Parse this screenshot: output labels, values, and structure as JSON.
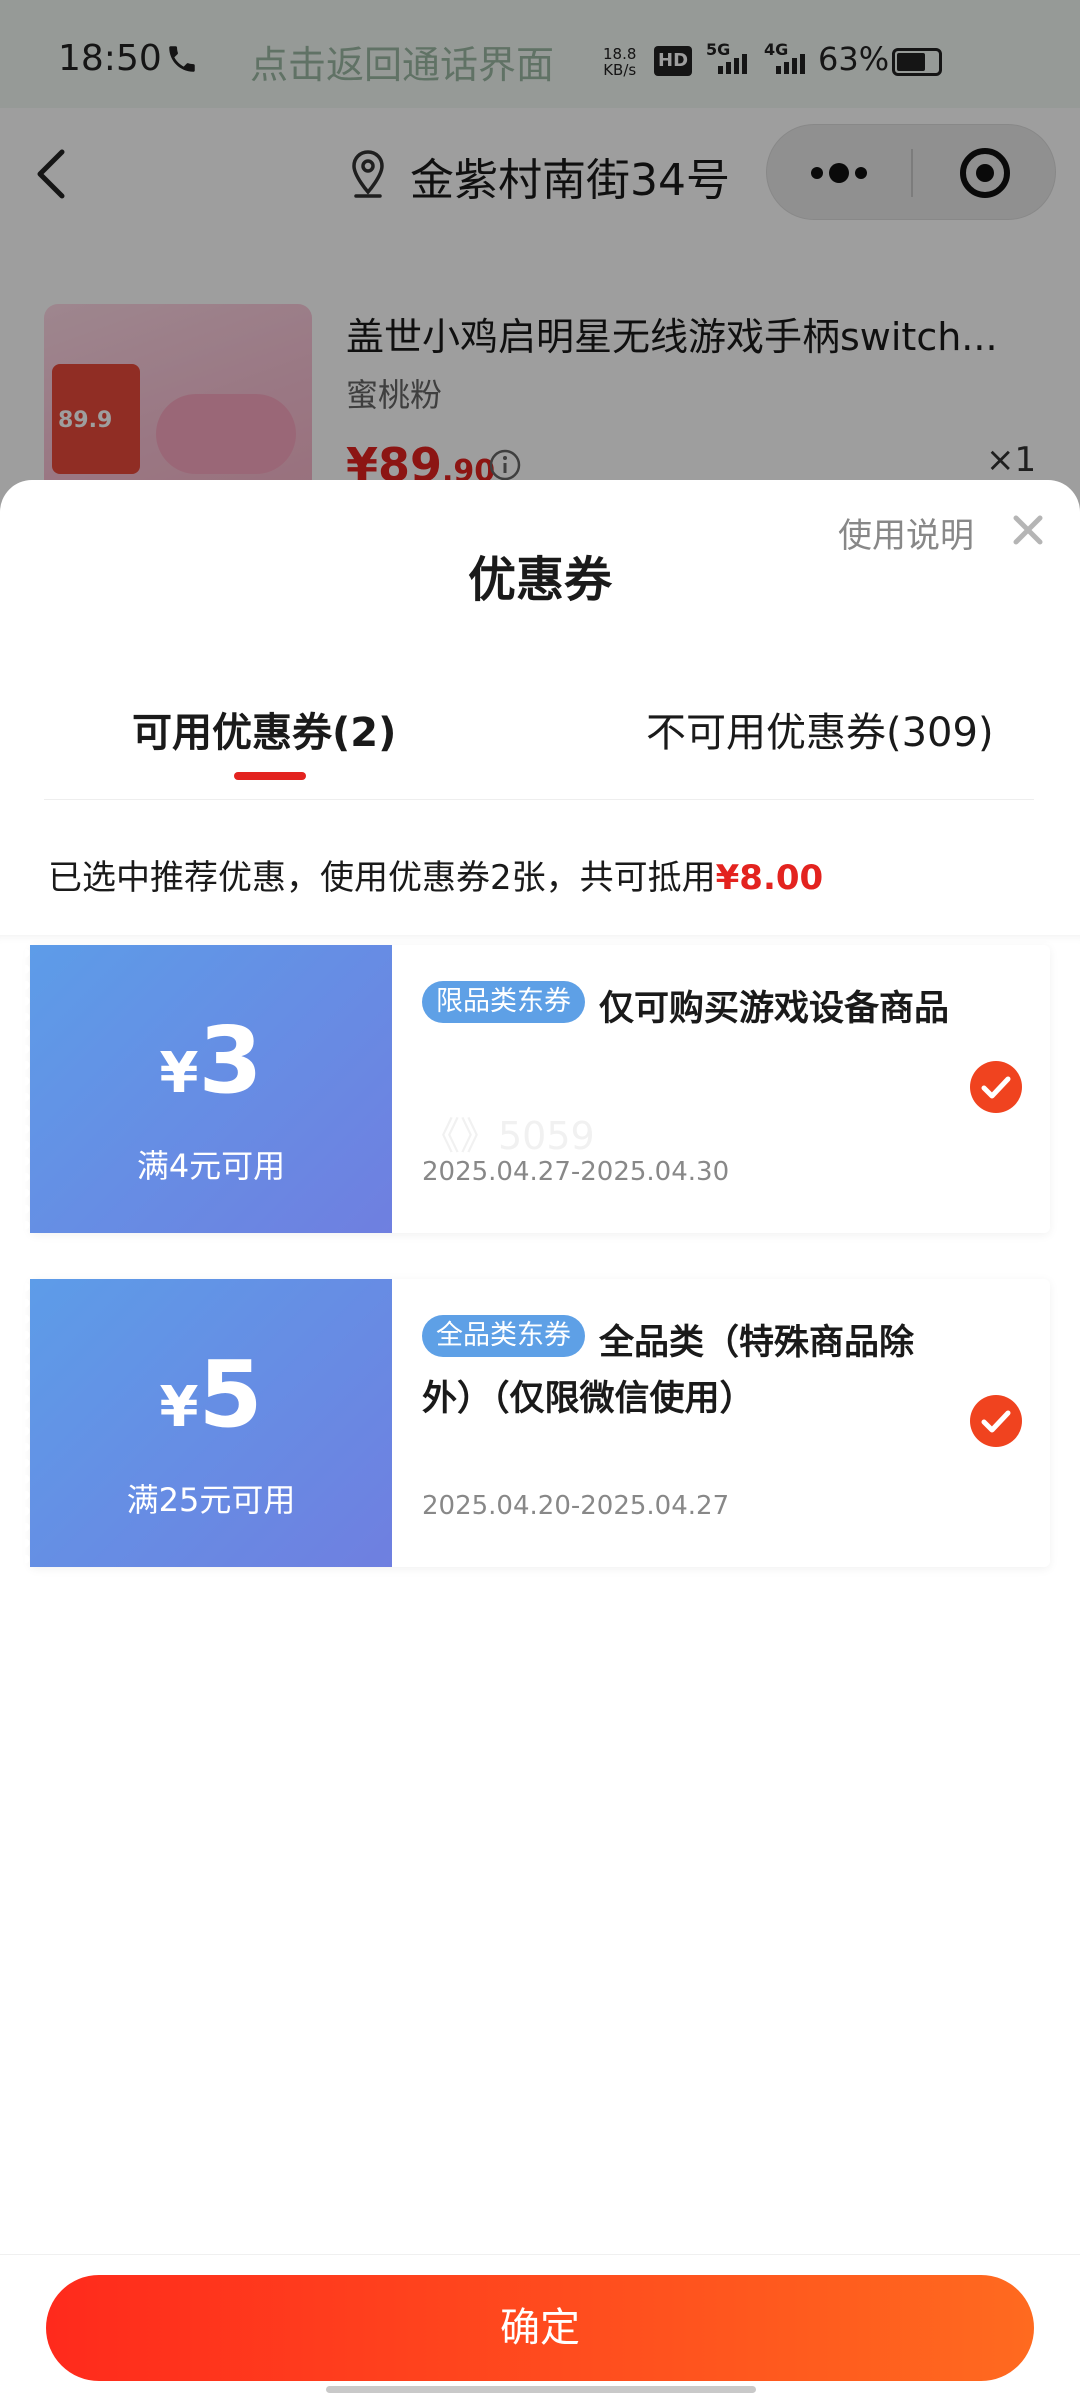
{
  "status_bar": {
    "time": "18:50",
    "call_text": "点击返回通话界面",
    "net_speed_top": "18.8",
    "net_speed_bottom": "KB/s",
    "hd_label": "HD",
    "signal_1_label": "5G",
    "signal_2_label": "4G",
    "battery_percent": "63%",
    "battery_level": 0.63
  },
  "nav": {
    "location": "金紫村南街34号"
  },
  "product": {
    "title": "盖世小鸡启明星无线游戏手柄switch...",
    "variant": "蜜桃粉",
    "price_main": "¥89",
    "price_decimal": ".90",
    "quantity": "×1",
    "thumb_price": "89.9"
  },
  "sheet": {
    "help_link": "使用说明",
    "title": "优惠券",
    "tab_available": "可用优惠券(2)",
    "tab_unavailable": "不可用优惠券(309)",
    "summary_prefix": "已选中推荐优惠，使用优惠券2张，共可抵用",
    "summary_amount": "¥8.00"
  },
  "coupons": [
    {
      "yen": "¥",
      "amount": "3",
      "condition": "满4元可用",
      "tag": "限品类东券",
      "description": "仅可购买游戏设备商品",
      "date": "2025.04.27-2025.04.30",
      "watermark": "《》5059"
    },
    {
      "yen": "¥",
      "amount": "5",
      "condition": "满25元可用",
      "tag": "全品类东券",
      "description": "全品类（特殊商品除外）（仅限微信使用）",
      "date": "2025.04.20-2025.04.27"
    }
  ],
  "footer": {
    "confirm_label": "确定"
  },
  "colors": {
    "accent_red": "#e3231f",
    "coupon_blue": "#5d9ce8"
  }
}
